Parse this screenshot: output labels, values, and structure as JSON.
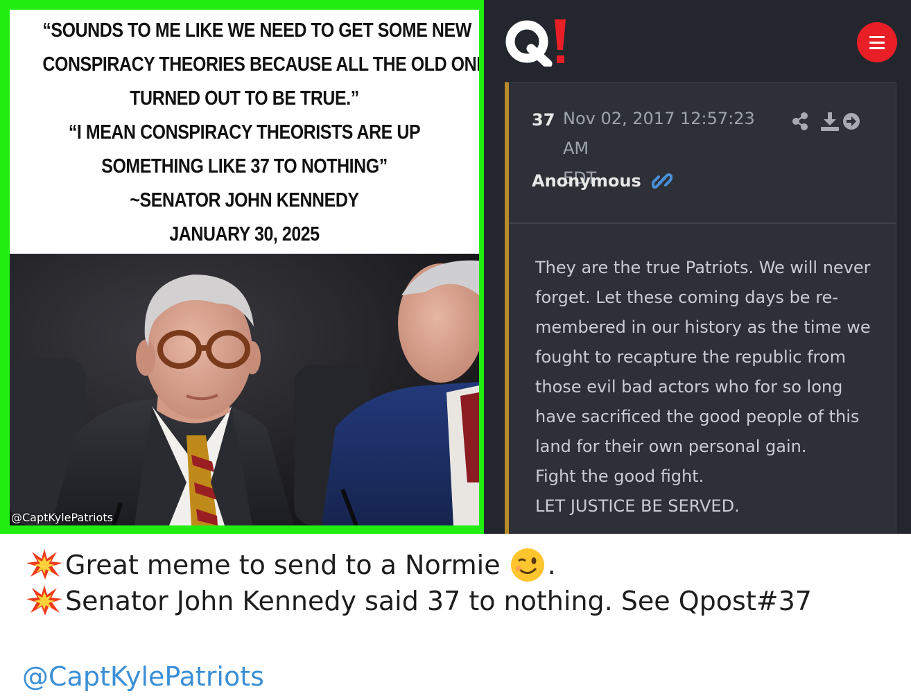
{
  "meme": {
    "quote_lines": [
      "“SOUNDS TO ME LIKE WE NEED TO GET SOME NEW",
      "CONSPIRACY THEORIES BECAUSE ALL THE OLD ONES",
      "TURNED OUT TO BE TRUE.”",
      "“I MEAN CONSPIRACY THEORISTS ARE UP",
      "SOMETHING LIKE 37 TO NOTHING”",
      "~SENATOR JOHN KENNEDY",
      "JANUARY 30, 2025"
    ],
    "watermark": "@CaptKylePatriots",
    "border_color": "#22ee11"
  },
  "qpost": {
    "logo_icon": "q-logo-icon",
    "menu_icon": "hamburger-menu-icon",
    "number": "37",
    "date_line1": "Nov 02, 2017 12:57:23 AM",
    "date_line2": "EDT",
    "author": "Anonymous",
    "icons": [
      "share-icon",
      "download-icon",
      "arrow-right-circle-icon",
      "link-icon"
    ],
    "body_lines": [
      "They are the true Patriots. We will never",
      "forget. Let these coming days be re-",
      "membered in our history as the time we",
      "fought to recapture the republic from",
      "those evil bad actors who for so long",
      "have sacrificed the good people of this",
      "land for their own personal gain.",
      "Fight the good fight.",
      "LET JUSTICE BE SERVED."
    ],
    "accent_color": "#b88a2a",
    "menu_color": "#e81f27"
  },
  "caption": {
    "line1_text": "Great meme to send to a Normie",
    "line1_end": ".",
    "line2_text": "Senator John Kennedy said 37 to nothing. See Qpost#37",
    "emoji_icons": [
      "collision-icon",
      "winking-face-icon"
    ],
    "handle": "@CaptKylePatriots",
    "handle_color": "#3a8fd6"
  }
}
